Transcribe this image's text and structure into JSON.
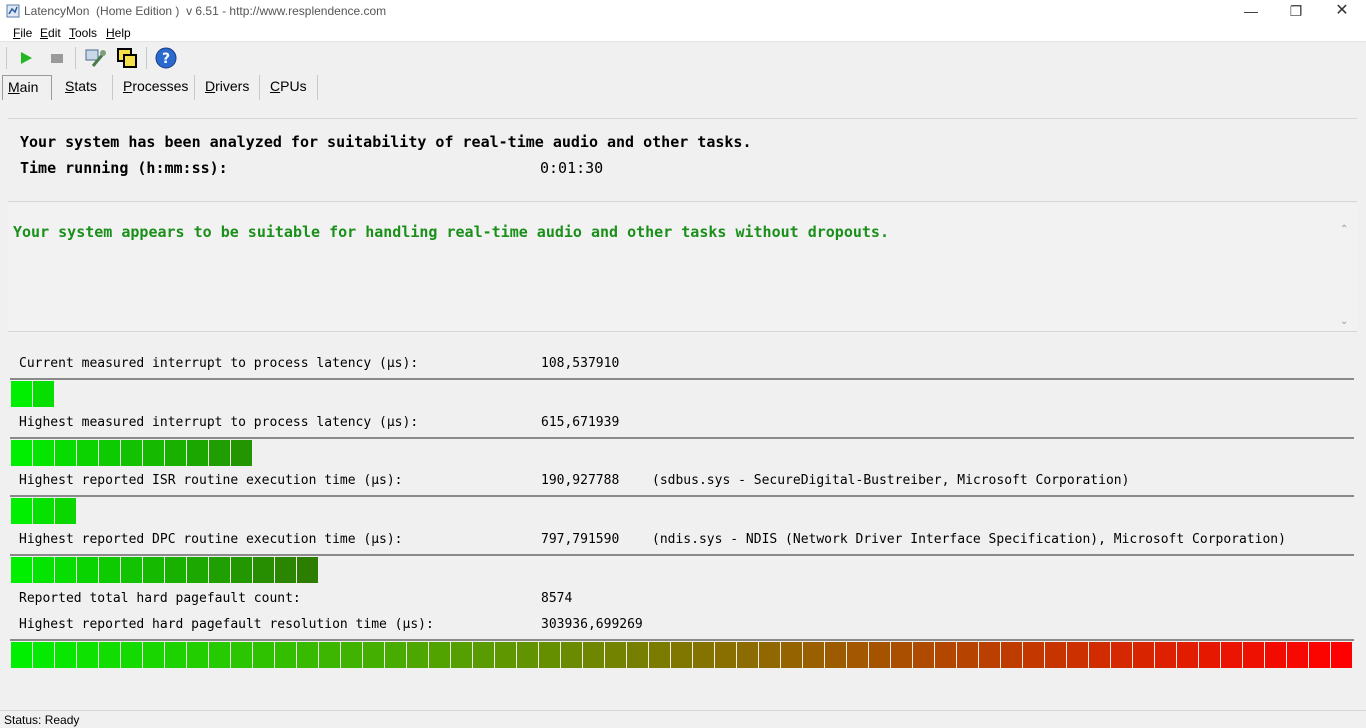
{
  "window": {
    "title": "LatencyMon  (Home Edition )  v 6.51 - http://www.resplendence.com",
    "minimize_glyph": "—",
    "maximize_glyph": "❐",
    "close_glyph": "✕"
  },
  "menu": {
    "items": [
      {
        "label": "File",
        "mnemonic": "F",
        "rest": "ile"
      },
      {
        "label": "Edit",
        "mnemonic": "E",
        "rest": "dit"
      },
      {
        "label": "Tools",
        "mnemonic": "T",
        "rest": "ools"
      },
      {
        "label": "Help",
        "mnemonic": "H",
        "rest": "elp"
      }
    ]
  },
  "toolbar": {
    "icons": [
      "play-icon",
      "stop-icon",
      "tools-icon",
      "windows-icon",
      "help-icon"
    ]
  },
  "tabs": [
    {
      "label": "Main",
      "mnemonic": "M",
      "rest": "ain",
      "active": true
    },
    {
      "label": "Stats",
      "mnemonic": "S",
      "rest": "tats",
      "active": false
    },
    {
      "label": "Processes",
      "mnemonic": "P",
      "rest": "rocesses",
      "active": false
    },
    {
      "label": "Drivers",
      "mnemonic": "D",
      "rest": "rivers",
      "active": false
    },
    {
      "label": "CPUs",
      "mnemonic": "C",
      "rest": "PUs",
      "active": false
    }
  ],
  "summary": {
    "analyzed_text": "Your system has been analyzed for suitability of real-time audio and other tasks.",
    "time_label": "Time running (h:mm:ss):",
    "time_value": "0:01:30"
  },
  "conclusion": {
    "text": "Your system appears to be suitable for handling real-time audio and other tasks without dropouts.",
    "color": "#1a8f1a"
  },
  "metrics": [
    {
      "label": "Current measured interrupt to process latency (µs):",
      "value": "108,537910",
      "driver": "",
      "bar_segments": 2
    },
    {
      "label": "Highest measured interrupt to process latency (µs):",
      "value": "615,671939",
      "driver": "",
      "bar_segments": 11
    },
    {
      "label": "Highest reported ISR routine execution time (µs):",
      "value": "190,927788",
      "driver": "(sdbus.sys - SecureDigital-Bustreiber, Microsoft Corporation)",
      "bar_segments": 3
    },
    {
      "label": "Highest reported DPC routine execution time (µs):",
      "value": "797,791590",
      "driver": "(ndis.sys - NDIS (Network Driver Interface Specification), Microsoft Corporation)",
      "bar_segments": 14
    }
  ],
  "pagefault": {
    "count_label": "Reported total hard pagefault count:",
    "count_value": "8574",
    "time_label": "Highest reported hard pagefault resolution time (µs):",
    "time_value": "303936,699269",
    "bar_segments": 61
  },
  "status": {
    "text": "Status: Ready"
  },
  "colors": {
    "bar_start": "#00ee00",
    "bar_end": "#ff0000",
    "small_bar_dark": "#2d7d00"
  }
}
